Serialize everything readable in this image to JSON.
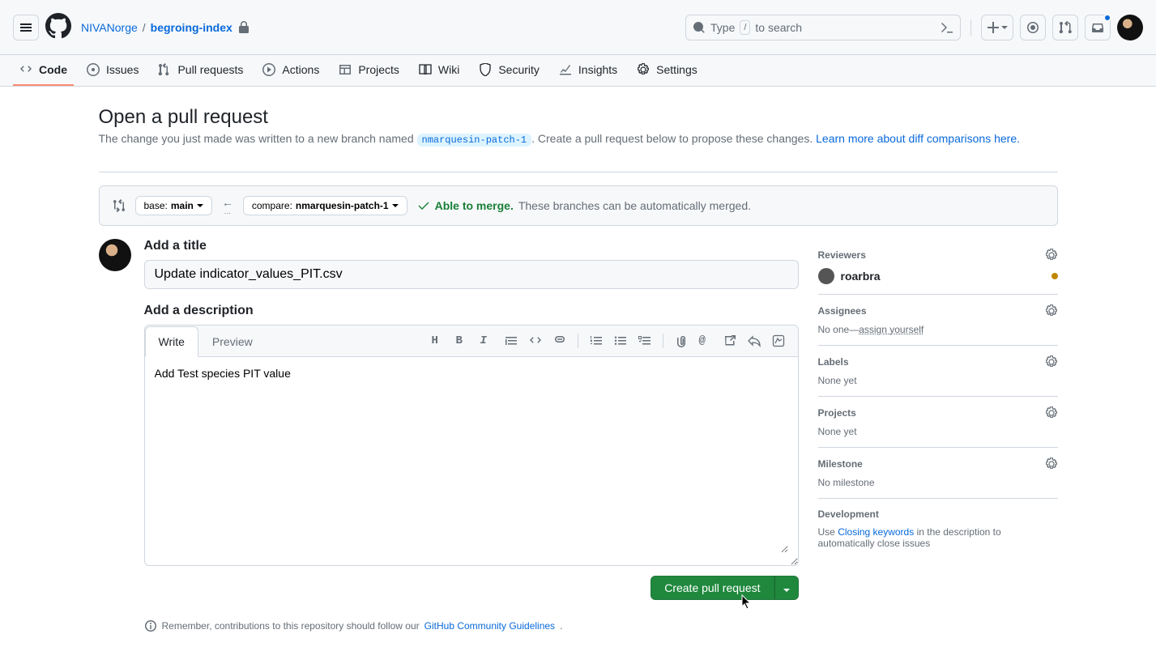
{
  "header": {
    "owner": "NIVANorge",
    "repo": "begroing-index",
    "search_placeholder": "Type",
    "search_suffix": "to search",
    "search_kbd": "/"
  },
  "nav": {
    "items": [
      {
        "label": "Code",
        "active": true
      },
      {
        "label": "Issues"
      },
      {
        "label": "Pull requests"
      },
      {
        "label": "Actions"
      },
      {
        "label": "Projects"
      },
      {
        "label": "Wiki"
      },
      {
        "label": "Security"
      },
      {
        "label": "Insights"
      },
      {
        "label": "Settings"
      }
    ]
  },
  "page": {
    "title": "Open a pull request",
    "subtitle_prefix": "The change you just made was written to a new branch named ",
    "branch_name": "nmarquesin-patch-1",
    "subtitle_suffix": ". Create a pull request below to propose these changes. ",
    "learn_link": "Learn more about diff comparisons here."
  },
  "range": {
    "base_label": "base: ",
    "base_value": "main",
    "compare_label": "compare: ",
    "compare_value": "nmarquesin-patch-1",
    "arrow_dots": "…",
    "merge_ok": "Able to merge.",
    "merge_msg": "These branches can be automatically merged."
  },
  "form": {
    "title_label": "Add a title",
    "title_value": "Update indicator_values_PIT.csv",
    "desc_label": "Add a description",
    "tabs": {
      "write": "Write",
      "preview": "Preview"
    },
    "body": "Add Test species PIT value",
    "submit": "Create pull request"
  },
  "footer": {
    "prefix": "Remember, contributions to this repository should follow our ",
    "link": "GitHub Community Guidelines",
    "suffix": "."
  },
  "sidebar": {
    "reviewers": {
      "title": "Reviewers",
      "user": "roarbra"
    },
    "assignees": {
      "title": "Assignees",
      "none_prefix": "No one—",
      "assign": "assign yourself"
    },
    "labels": {
      "title": "Labels",
      "none": "None yet"
    },
    "projects": {
      "title": "Projects",
      "none": "None yet"
    },
    "milestone": {
      "title": "Milestone",
      "none": "No milestone"
    },
    "development": {
      "title": "Development",
      "prefix": "Use ",
      "link": "Closing keywords",
      "suffix": " in the description to automatically close issues"
    }
  }
}
